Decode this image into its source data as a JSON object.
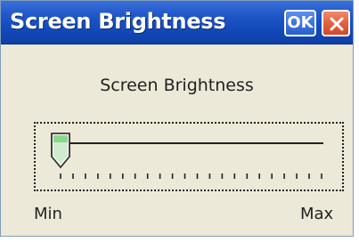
{
  "window": {
    "title": "Screen Brightness",
    "ok_label": "OK"
  },
  "content": {
    "heading": "Screen Brightness"
  },
  "slider": {
    "min_label": "Min",
    "max_label": "Max",
    "value_fraction": 0.0,
    "tick_count": 22
  },
  "colors": {
    "titlebar": "#1f56c8",
    "ok_button": "#3f74e0",
    "close_button": "#e2613f",
    "thumb_fill": "#8bd88b",
    "window_bg": "#ece9d8"
  },
  "icons": {
    "close": "close-icon",
    "thumb": "slider-thumb"
  }
}
